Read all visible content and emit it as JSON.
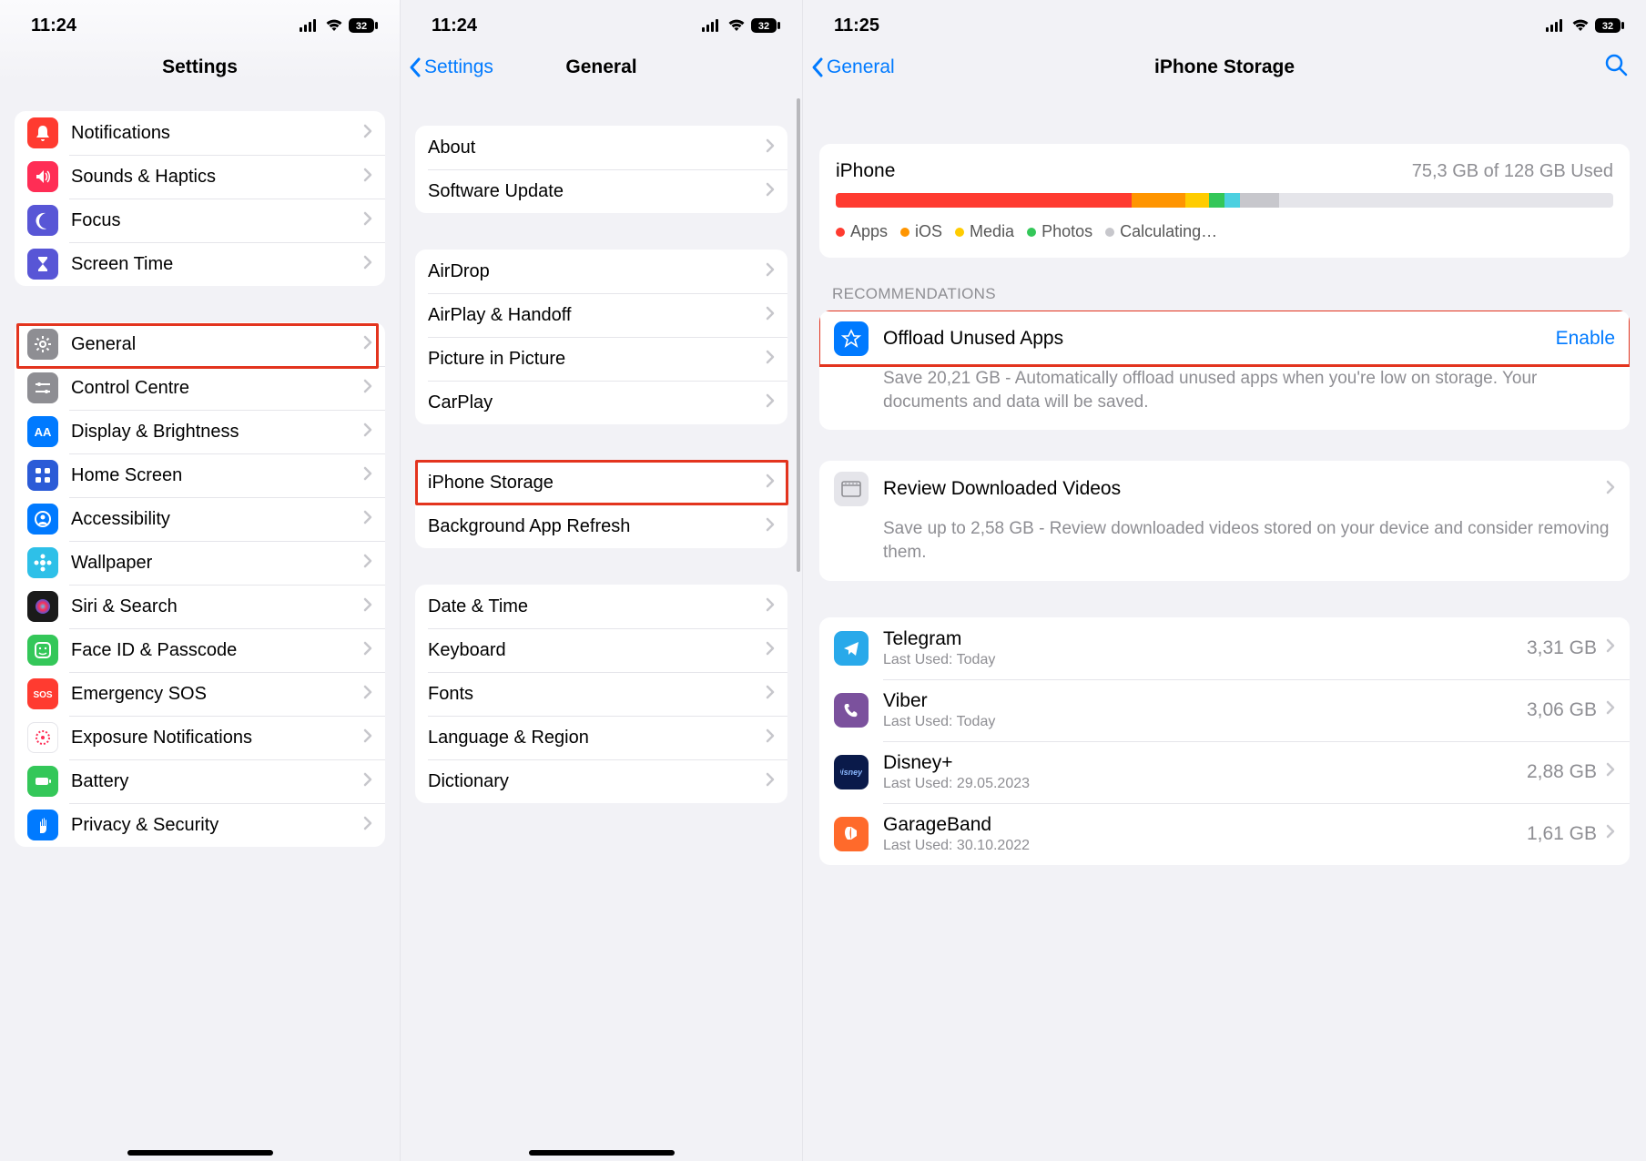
{
  "status": {
    "time1": "11:24",
    "time2": "11:24",
    "time3": "11:25",
    "battery": "32"
  },
  "pane1": {
    "title": "Settings",
    "groupA": [
      {
        "label": "Notifications",
        "bg": "#ff3b30",
        "icon": "bell"
      },
      {
        "label": "Sounds & Haptics",
        "bg": "#ff2d55",
        "icon": "sound"
      },
      {
        "label": "Focus",
        "bg": "#5856d6",
        "icon": "moon"
      },
      {
        "label": "Screen Time",
        "bg": "#5856d6",
        "icon": "hourglass"
      }
    ],
    "groupB": [
      {
        "label": "General",
        "bg": "#8e8e93",
        "icon": "gear"
      },
      {
        "label": "Control Centre",
        "bg": "#8e8e93",
        "icon": "sliders"
      },
      {
        "label": "Display & Brightness",
        "bg": "#007aff",
        "icon": "aa"
      },
      {
        "label": "Home Screen",
        "bg": "#2b5bd7",
        "icon": "grid"
      },
      {
        "label": "Accessibility",
        "bg": "#007aff",
        "icon": "person"
      },
      {
        "label": "Wallpaper",
        "bg": "#2ec0e8",
        "icon": "flower"
      },
      {
        "label": "Siri & Search",
        "bg": "#1a1a1a",
        "icon": "siri"
      },
      {
        "label": "Face ID & Passcode",
        "bg": "#34c759",
        "icon": "face"
      },
      {
        "label": "Emergency SOS",
        "bg": "#ff3b30",
        "icon": "sos"
      },
      {
        "label": "Exposure Notifications",
        "bg": "#ffffff",
        "icon": "en"
      },
      {
        "label": "Battery",
        "bg": "#34c759",
        "icon": "battery"
      },
      {
        "label": "Privacy & Security",
        "bg": "#007aff",
        "icon": "hand"
      }
    ]
  },
  "pane2": {
    "back": "Settings",
    "title": "General",
    "groupA": [
      "About",
      "Software Update"
    ],
    "groupB": [
      "AirDrop",
      "AirPlay & Handoff",
      "Picture in Picture",
      "CarPlay"
    ],
    "groupC": [
      "iPhone Storage",
      "Background App Refresh"
    ],
    "groupD": [
      "Date & Time",
      "Keyboard",
      "Fonts",
      "Language & Region",
      "Dictionary"
    ]
  },
  "pane3": {
    "back": "General",
    "title": "iPhone Storage",
    "device": "iPhone",
    "used_text": "75,3 GB of 128 GB Used",
    "segments": [
      {
        "color": "#ff3b30",
        "pct": 38
      },
      {
        "color": "#ff9500",
        "pct": 7
      },
      {
        "color": "#ffcc00",
        "pct": 3
      },
      {
        "color": "#34c759",
        "pct": 2
      },
      {
        "color": "#4cd0e0",
        "pct": 2
      },
      {
        "color": "#c7c7cc",
        "pct": 5
      }
    ],
    "legend": [
      {
        "color": "#ff3b30",
        "label": "Apps"
      },
      {
        "color": "#ff9500",
        "label": "iOS"
      },
      {
        "color": "#ffcc00",
        "label": "Media"
      },
      {
        "color": "#34c759",
        "label": "Photos"
      },
      {
        "color": "#c7c7cc",
        "label": "Calculating…"
      }
    ],
    "rec_header": "RECOMMENDATIONS",
    "reco1": {
      "label": "Offload Unused Apps",
      "action": "Enable",
      "desc": "Save 20,21 GB - Automatically offload unused apps when you're low on storage. Your documents and data will be saved."
    },
    "reco2": {
      "label": "Review Downloaded Videos",
      "desc": "Save up to 2,58 GB - Review downloaded videos stored on your device and consider removing them."
    },
    "apps": [
      {
        "name": "Telegram",
        "sub": "Last Used: Today",
        "size": "3,31 GB",
        "bg": "#29a9ea"
      },
      {
        "name": "Viber",
        "sub": "Last Used: Today",
        "size": "3,06 GB",
        "bg": "#7b519d"
      },
      {
        "name": "Disney+",
        "sub": "Last Used: 29.05.2023",
        "size": "2,88 GB",
        "bg": "#0a1a4a"
      },
      {
        "name": "GarageBand",
        "sub": "Last Used: 30.10.2022",
        "size": "1,61 GB",
        "bg": "#ff6a2b"
      }
    ]
  }
}
